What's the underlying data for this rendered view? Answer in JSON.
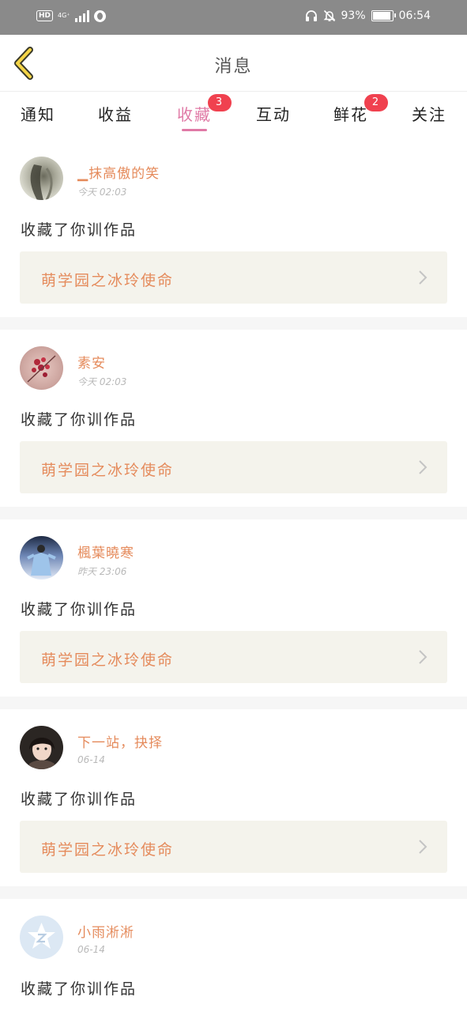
{
  "status_bar": {
    "hd_label": "HD",
    "network_label": "4G⁺",
    "battery_percent": "93%",
    "battery_level": 0.93,
    "time": "06:54",
    "icons": [
      "signal-bars-icon",
      "vpn-globe-icon",
      "headset-icon",
      "bell-muted-icon",
      "battery-icon"
    ]
  },
  "header": {
    "title": "消息",
    "back_icon": "chevron-left-icon"
  },
  "tabs": [
    {
      "label": "通知",
      "badge": "",
      "active": false
    },
    {
      "label": "收益",
      "badge": "",
      "active": false
    },
    {
      "label": "收藏",
      "badge": "3",
      "active": true
    },
    {
      "label": "互动",
      "badge": "",
      "active": false
    },
    {
      "label": "鲜花",
      "badge": "2",
      "active": false
    },
    {
      "label": "关注",
      "badge": "",
      "active": false
    }
  ],
  "colors": {
    "accent_pink": "#e07aa6",
    "name_orange": "#e58b5c",
    "badge_red": "#f0414f",
    "work_bg": "#f4f3ec",
    "status_bar_gray": "#8a8a8a"
  },
  "messages": [
    {
      "user": "▁抹高傲的笑",
      "time": "今天 02:03",
      "action": "收藏了你训作品",
      "work_title": "萌学园之冰玲使命",
      "avatar": "gray-photo-avatar"
    },
    {
      "user": "素安",
      "time": "今天 02:03",
      "action": "收藏了你训作品",
      "work_title": "萌学园之冰玲使命",
      "avatar": "plum-blossom-avatar"
    },
    {
      "user": "楓葉曉寒",
      "time": "昨天 23:06",
      "action": "收藏了你训作品",
      "work_title": "萌学园之冰玲使命",
      "avatar": "costume-figure-avatar"
    },
    {
      "user": "下一站，抉择",
      "time": "06-14",
      "action": "收藏了你训作品",
      "work_title": "萌学园之冰玲使命",
      "avatar": "girl-portrait-avatar"
    },
    {
      "user": "小雨淅淅",
      "time": "06-14",
      "action": "收藏了你训作品",
      "work_title": "",
      "avatar": "default-star-avatar"
    }
  ]
}
